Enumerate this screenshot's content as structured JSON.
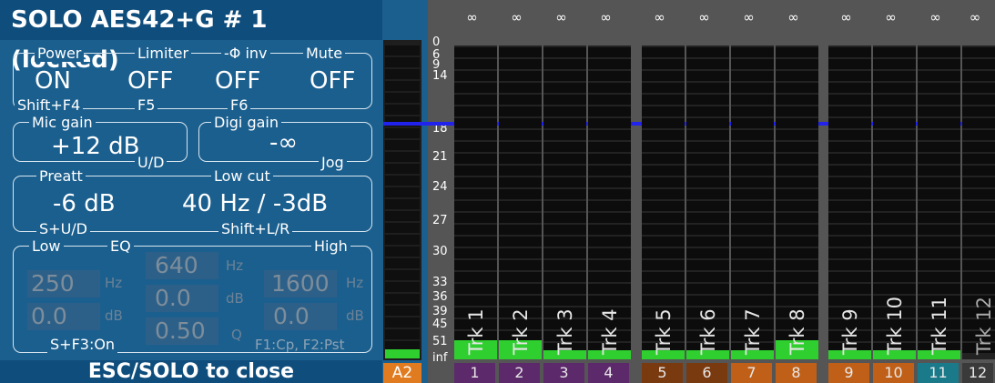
{
  "title": "SOLO AES42+G # 1 (locked)",
  "footer": "ESC/SOLO to close",
  "top": {
    "labels": [
      "Power",
      "Limiter",
      "-Φ inv",
      "Mute"
    ],
    "values": [
      "ON",
      "OFF",
      "OFF",
      "OFF"
    ],
    "keys": [
      "Shift+F4",
      "F5",
      "F6"
    ]
  },
  "mic_gain": {
    "label": "Mic gain",
    "value": "+12 dB",
    "key": "U/D"
  },
  "digi_gain": {
    "label": "Digi gain",
    "value": "-∞",
    "key": "Jog"
  },
  "preatt": {
    "label": "Preatt",
    "value": "-6 dB",
    "key": "S+U/D"
  },
  "low_cut": {
    "label": "Low cut",
    "value": "40 Hz / -3dB",
    "key": "Shift+L/R"
  },
  "eq": {
    "label": "EQ",
    "low": "Low",
    "high": "High",
    "low_freq": "250",
    "low_freq_unit": "Hz",
    "low_gain": "0.0",
    "low_gain_unit": "dB",
    "mid_freq": "640",
    "mid_freq_unit": "Hz",
    "mid_gain": "0.0",
    "mid_gain_unit": "dB",
    "mid_q": "0.50",
    "mid_q_unit": "Q",
    "high_freq": "1600",
    "high_freq_unit": "Hz",
    "high_gain": "0.0",
    "high_gain_unit": "dB",
    "key_on": "S+F3:On",
    "key_copy": "F1:Cp, F2:Pst"
  },
  "meter_tag": "A2",
  "scale": [
    "0",
    "6",
    "9",
    "14",
    "18",
    "21",
    "24",
    "27",
    "30",
    "33",
    "36",
    "39",
    "45",
    "51",
    "inf"
  ],
  "channels": [
    {
      "label": "Trk 1",
      "num": "1",
      "inf": "∞",
      "color": "#5c2a6b",
      "level": 0.06
    },
    {
      "label": "Trk 2",
      "num": "2",
      "inf": "∞",
      "color": "#5c2a6b",
      "level": 0.06
    },
    {
      "label": "Trk 3",
      "num": "3",
      "inf": "∞",
      "color": "#5c2a6b",
      "level": 0.03
    },
    {
      "label": "Trk 4",
      "num": "4",
      "inf": "∞",
      "color": "#5c2a6b",
      "level": 0.03
    },
    {
      "label": "Trk 5",
      "num": "5",
      "inf": "∞",
      "color": "#7a3a10",
      "level": 0.03
    },
    {
      "label": "Trk 6",
      "num": "6",
      "inf": "∞",
      "color": "#7a3a10",
      "level": 0.03
    },
    {
      "label": "Trk 7",
      "num": "7",
      "inf": "∞",
      "color": "#c06018",
      "level": 0.03
    },
    {
      "label": "Trk 8",
      "num": "8",
      "inf": "∞",
      "color": "#c06018",
      "level": 0.06
    },
    {
      "label": "Trk 9",
      "num": "9",
      "inf": "∞",
      "color": "#c06018",
      "level": 0.03
    },
    {
      "label": "Trk 10",
      "num": "10",
      "inf": "∞",
      "color": "#c06018",
      "level": 0.03
    },
    {
      "label": "Trk 11",
      "num": "11",
      "inf": "∞",
      "color": "#1a7a8a",
      "level": 0.03
    },
    {
      "label": "Trk 12",
      "num": "12",
      "inf": "∞",
      "color": "#3a3a3a",
      "level": 0
    }
  ]
}
